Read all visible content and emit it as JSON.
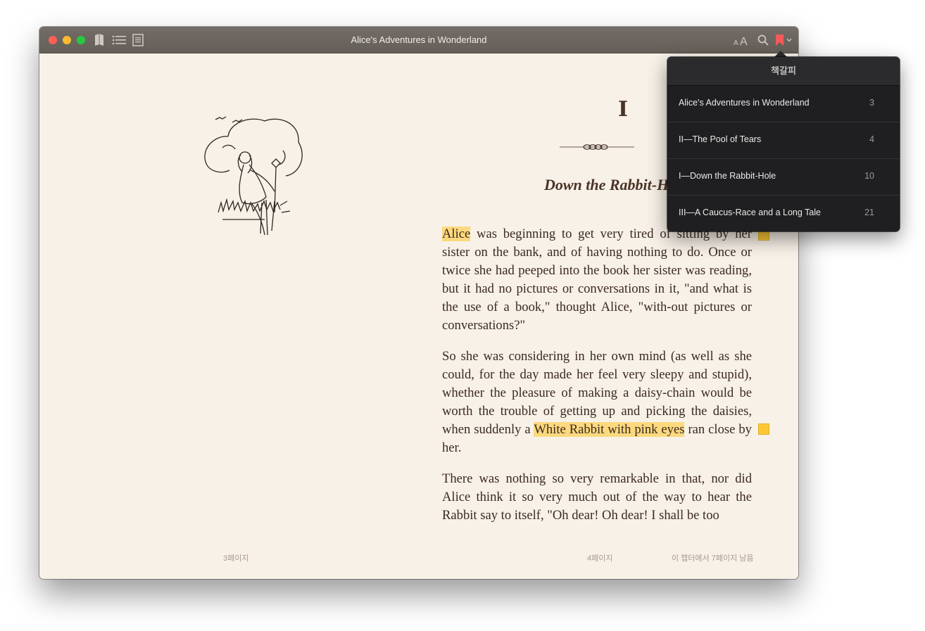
{
  "window": {
    "title": "Alice's Adventures in Wonderland"
  },
  "toolbar": {
    "icons": [
      "library-icon",
      "toc-icon",
      "notes-icon",
      "font-size-icon",
      "search-icon",
      "bookmark-icon",
      "chevron-down-icon"
    ]
  },
  "book": {
    "chapter_number": "I",
    "chapter_title": "Down the Rabbit-Hole",
    "paragraphs": [
      {
        "highlight_start": "Alice",
        "rest": " was beginning to get very tired of sitting by her sister on the bank, and of having nothing to do. Once or twice she had peeped into the book her sister was reading, but it had no pictures or conversations in it, \"and what is the use of a book,\" thought Alice, \"with-out pictures or conversations?\""
      },
      {
        "before": "So she was considering in her own mind (as well as she could, for the day made her feel very sleepy and stupid), whether the pleasure of making a daisy-chain would be worth the trouble of getting up and picking the daisies, when suddenly a ",
        "highlight": "White Rabbit with pink eyes",
        "after": " ran close by her."
      },
      {
        "text": "There was nothing so very remarkable in that, nor did Alice think it so very much out of the way to hear the Rabbit say to itself, \"Oh dear! Oh dear! I shall be too"
      }
    ],
    "left_page_label": "3페이지",
    "right_page_label": "4페이지",
    "chapter_remaining": "이 챕터에서 7페이지 남음",
    "highlight_color": "#fcd97e"
  },
  "bookmarks_popover": {
    "title": "책갈피",
    "items": [
      {
        "label": "Alice's Adventures in Wonderland",
        "page": "3"
      },
      {
        "label": "II—The Pool of Tears",
        "page": "4"
      },
      {
        "label": "I—Down the Rabbit-Hole",
        "page": "10"
      },
      {
        "label": "III—A Caucus-Race and a Long Tale",
        "page": "21"
      }
    ]
  },
  "colors": {
    "titlebar": "#6e6761",
    "page_bg": "#f8f1e8",
    "text": "#3b2a20",
    "bookmark_red": "#f25b5b",
    "popover_bg": "#1f1f21"
  }
}
